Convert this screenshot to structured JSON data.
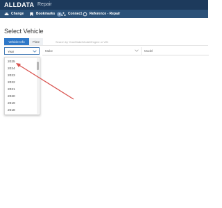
{
  "app": {
    "brand": "ALLDATA",
    "product": "Repair"
  },
  "nav": {
    "items": [
      {
        "label": "Change",
        "icon": "car-change-icon"
      },
      {
        "label": "Bookmarks",
        "icon": "bookmark-icon",
        "badge": "0"
      },
      {
        "label": "Connect",
        "icon": "connect-icon"
      },
      {
        "label": "Reference - Repair",
        "icon": "reference-icon"
      }
    ]
  },
  "page": {
    "title": "Select Vehicle"
  },
  "tabs": {
    "active": "Vehicle Info",
    "plate": "Plate",
    "search_placeholder": "Search by Year/Make/Model/Engine or VIN"
  },
  "selectors": {
    "year": {
      "label": "Year"
    },
    "make": {
      "label": "Make"
    },
    "model": {
      "label": "Model"
    }
  },
  "year_options": [
    "2025",
    "2024",
    "2023",
    "2022",
    "2021",
    "2020",
    "2019",
    "2018"
  ],
  "colors": {
    "topbar": "#1d3a5c",
    "navbar": "#2b5178",
    "accent": "#2f78c8",
    "arrow": "#d9534f"
  }
}
